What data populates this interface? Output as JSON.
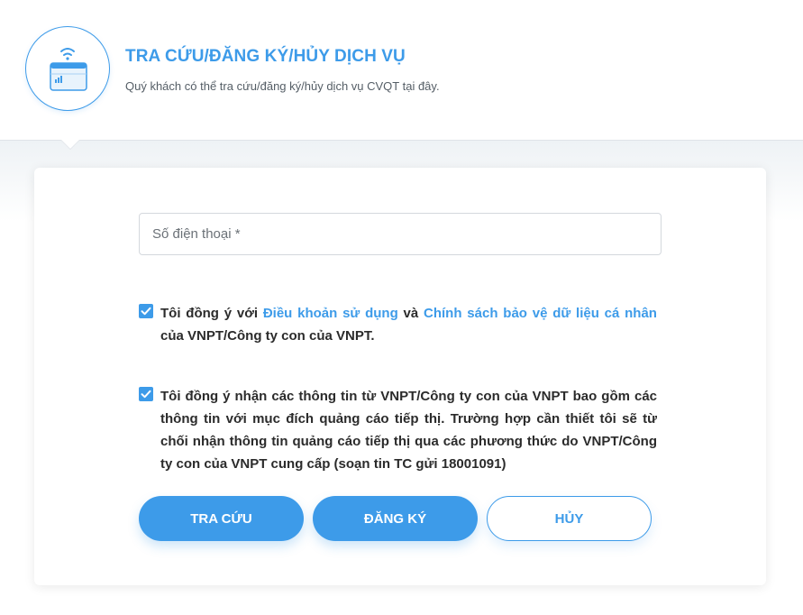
{
  "header": {
    "title": "TRA CỨU/ĐĂNG KÝ/HỦY DỊCH VỤ",
    "subtitle": "Quý khách có thể tra cứu/đăng ký/hủy dịch vụ CVQT tại đây.",
    "icon": "phone-wifi-icon"
  },
  "form": {
    "phone_placeholder": "Số điện thoại *",
    "phone_value": "",
    "consent_terms": {
      "checked": true,
      "text_before": "Tôi đồng ý với ",
      "link_terms": "Điều khoản sử dụng",
      "text_and": " và ",
      "link_policy": "Chính sách bảo vệ dữ liệu cá nhân",
      "text_after": " của VNPT/Công ty con của VNPT."
    },
    "consent_marketing": {
      "checked": true,
      "text": "Tôi đồng ý nhận các thông tin từ VNPT/Công ty con của VNPT bao gồm các thông tin với mục đích quảng cáo tiếp thị. Trường hợp cần thiết tôi sẽ từ chối nhận thông tin quảng cáo tiếp thị qua các phương thức do VNPT/Công ty con của VNPT cung cấp (soạn tin TC gửi 18001091)"
    }
  },
  "buttons": {
    "lookup": "TRA CỨU",
    "register": "ĐĂNG KÝ",
    "cancel": "HỦY"
  },
  "colors": {
    "accent": "#3d9be9",
    "text": "#2b2b2b"
  }
}
